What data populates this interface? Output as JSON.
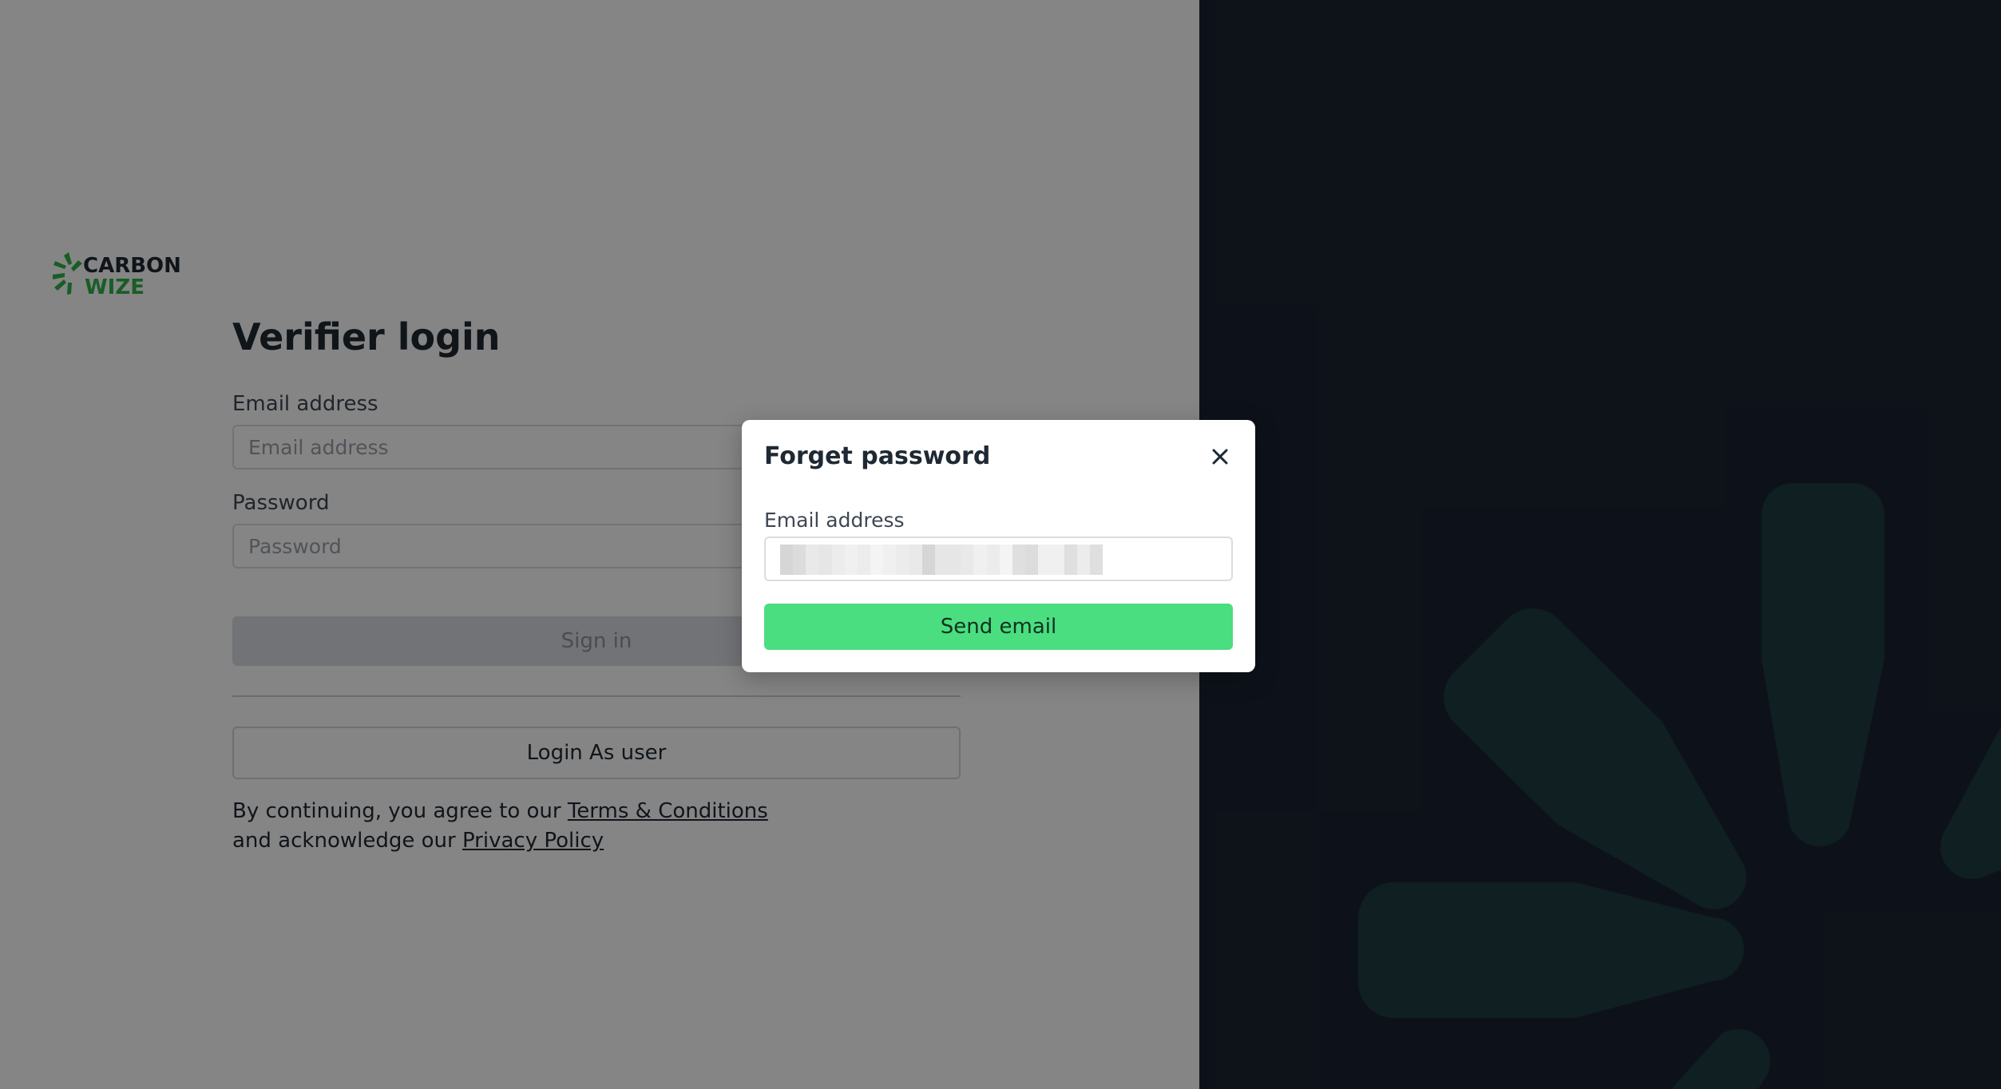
{
  "brand": {
    "logo_text_line1": "CARBON",
    "logo_text_line2": "WIZE",
    "logo_icon": "carbonwize-burst-icon",
    "colors": {
      "brand_dark": "#1f2933",
      "brand_green": "#2fb34a",
      "panel_dark": "#1a2432",
      "decor_teal": "#1d3d42",
      "accent_green": "#4ade80"
    }
  },
  "login": {
    "title": "Verifier login",
    "email_label": "Email address",
    "email_placeholder": "Email address",
    "password_label": "Password",
    "password_placeholder": "Password",
    "signin_label": "Sign in",
    "login_as_user_label": "Login As user",
    "legal_prefix": "By continuing, you agree to our ",
    "terms_link": "Terms & Conditions",
    "legal_middle": "and acknowledge our ",
    "privacy_link": "Privacy Policy"
  },
  "modal": {
    "title": "Forget password",
    "close_icon": "close-icon",
    "email_label": "Email address",
    "email_value": "",
    "send_label": "Send email"
  }
}
